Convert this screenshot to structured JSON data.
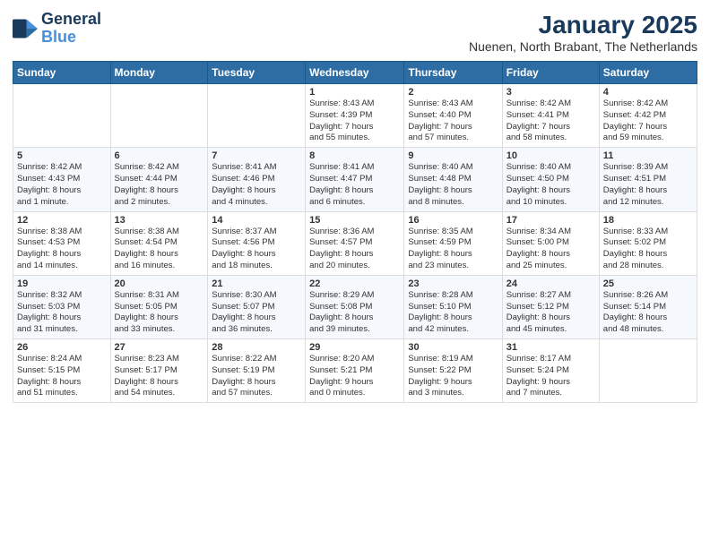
{
  "logo": {
    "line1": "General",
    "line2": "Blue"
  },
  "title": "January 2025",
  "subtitle": "Nuenen, North Brabant, The Netherlands",
  "days_of_week": [
    "Sunday",
    "Monday",
    "Tuesday",
    "Wednesday",
    "Thursday",
    "Friday",
    "Saturday"
  ],
  "weeks": [
    [
      {
        "day": "",
        "info": ""
      },
      {
        "day": "",
        "info": ""
      },
      {
        "day": "",
        "info": ""
      },
      {
        "day": "1",
        "info": "Sunrise: 8:43 AM\nSunset: 4:39 PM\nDaylight: 7 hours\nand 55 minutes."
      },
      {
        "day": "2",
        "info": "Sunrise: 8:43 AM\nSunset: 4:40 PM\nDaylight: 7 hours\nand 57 minutes."
      },
      {
        "day": "3",
        "info": "Sunrise: 8:42 AM\nSunset: 4:41 PM\nDaylight: 7 hours\nand 58 minutes."
      },
      {
        "day": "4",
        "info": "Sunrise: 8:42 AM\nSunset: 4:42 PM\nDaylight: 7 hours\nand 59 minutes."
      }
    ],
    [
      {
        "day": "5",
        "info": "Sunrise: 8:42 AM\nSunset: 4:43 PM\nDaylight: 8 hours\nand 1 minute."
      },
      {
        "day": "6",
        "info": "Sunrise: 8:42 AM\nSunset: 4:44 PM\nDaylight: 8 hours\nand 2 minutes."
      },
      {
        "day": "7",
        "info": "Sunrise: 8:41 AM\nSunset: 4:46 PM\nDaylight: 8 hours\nand 4 minutes."
      },
      {
        "day": "8",
        "info": "Sunrise: 8:41 AM\nSunset: 4:47 PM\nDaylight: 8 hours\nand 6 minutes."
      },
      {
        "day": "9",
        "info": "Sunrise: 8:40 AM\nSunset: 4:48 PM\nDaylight: 8 hours\nand 8 minutes."
      },
      {
        "day": "10",
        "info": "Sunrise: 8:40 AM\nSunset: 4:50 PM\nDaylight: 8 hours\nand 10 minutes."
      },
      {
        "day": "11",
        "info": "Sunrise: 8:39 AM\nSunset: 4:51 PM\nDaylight: 8 hours\nand 12 minutes."
      }
    ],
    [
      {
        "day": "12",
        "info": "Sunrise: 8:38 AM\nSunset: 4:53 PM\nDaylight: 8 hours\nand 14 minutes."
      },
      {
        "day": "13",
        "info": "Sunrise: 8:38 AM\nSunset: 4:54 PM\nDaylight: 8 hours\nand 16 minutes."
      },
      {
        "day": "14",
        "info": "Sunrise: 8:37 AM\nSunset: 4:56 PM\nDaylight: 8 hours\nand 18 minutes."
      },
      {
        "day": "15",
        "info": "Sunrise: 8:36 AM\nSunset: 4:57 PM\nDaylight: 8 hours\nand 20 minutes."
      },
      {
        "day": "16",
        "info": "Sunrise: 8:35 AM\nSunset: 4:59 PM\nDaylight: 8 hours\nand 23 minutes."
      },
      {
        "day": "17",
        "info": "Sunrise: 8:34 AM\nSunset: 5:00 PM\nDaylight: 8 hours\nand 25 minutes."
      },
      {
        "day": "18",
        "info": "Sunrise: 8:33 AM\nSunset: 5:02 PM\nDaylight: 8 hours\nand 28 minutes."
      }
    ],
    [
      {
        "day": "19",
        "info": "Sunrise: 8:32 AM\nSunset: 5:03 PM\nDaylight: 8 hours\nand 31 minutes."
      },
      {
        "day": "20",
        "info": "Sunrise: 8:31 AM\nSunset: 5:05 PM\nDaylight: 8 hours\nand 33 minutes."
      },
      {
        "day": "21",
        "info": "Sunrise: 8:30 AM\nSunset: 5:07 PM\nDaylight: 8 hours\nand 36 minutes."
      },
      {
        "day": "22",
        "info": "Sunrise: 8:29 AM\nSunset: 5:08 PM\nDaylight: 8 hours\nand 39 minutes."
      },
      {
        "day": "23",
        "info": "Sunrise: 8:28 AM\nSunset: 5:10 PM\nDaylight: 8 hours\nand 42 minutes."
      },
      {
        "day": "24",
        "info": "Sunrise: 8:27 AM\nSunset: 5:12 PM\nDaylight: 8 hours\nand 45 minutes."
      },
      {
        "day": "25",
        "info": "Sunrise: 8:26 AM\nSunset: 5:14 PM\nDaylight: 8 hours\nand 48 minutes."
      }
    ],
    [
      {
        "day": "26",
        "info": "Sunrise: 8:24 AM\nSunset: 5:15 PM\nDaylight: 8 hours\nand 51 minutes."
      },
      {
        "day": "27",
        "info": "Sunrise: 8:23 AM\nSunset: 5:17 PM\nDaylight: 8 hours\nand 54 minutes."
      },
      {
        "day": "28",
        "info": "Sunrise: 8:22 AM\nSunset: 5:19 PM\nDaylight: 8 hours\nand 57 minutes."
      },
      {
        "day": "29",
        "info": "Sunrise: 8:20 AM\nSunset: 5:21 PM\nDaylight: 9 hours\nand 0 minutes."
      },
      {
        "day": "30",
        "info": "Sunrise: 8:19 AM\nSunset: 5:22 PM\nDaylight: 9 hours\nand 3 minutes."
      },
      {
        "day": "31",
        "info": "Sunrise: 8:17 AM\nSunset: 5:24 PM\nDaylight: 9 hours\nand 7 minutes."
      },
      {
        "day": "",
        "info": ""
      }
    ]
  ]
}
